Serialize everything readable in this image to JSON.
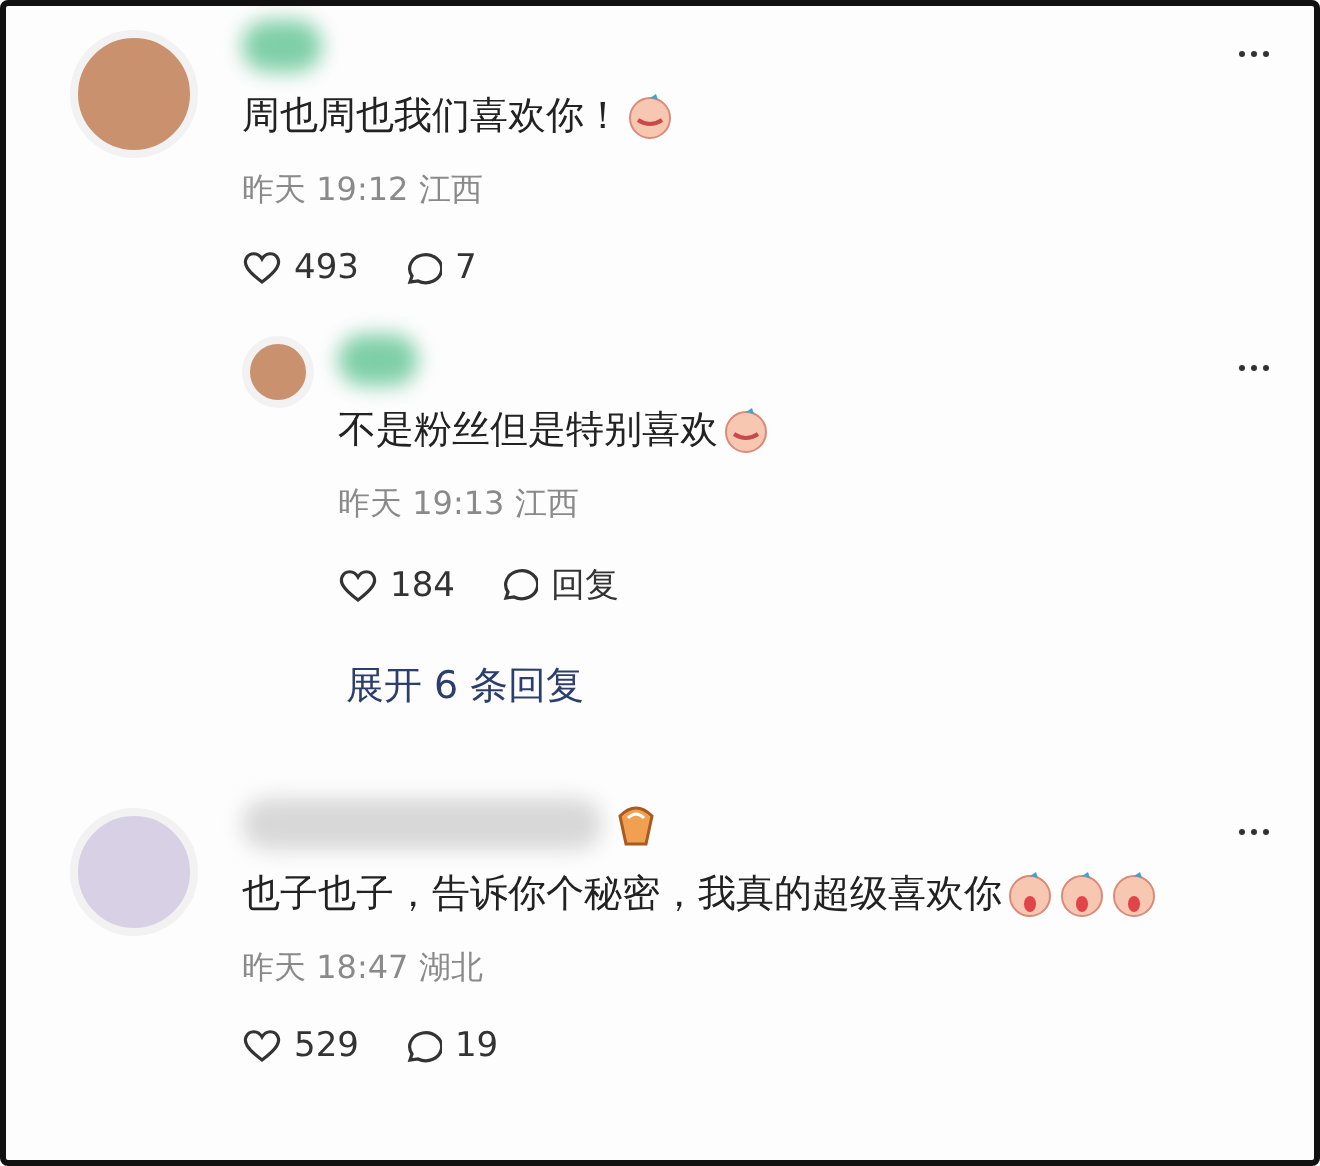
{
  "comments": [
    {
      "text": "周也周也我们喜欢你！",
      "stickers": [
        {
          "kind": "blush"
        }
      ],
      "has_badge": false,
      "time": "昨天 19:12 江西",
      "likes": "493",
      "replies_label": "7",
      "children": [
        {
          "text": "不是粉丝但是特别喜欢",
          "stickers": [
            {
              "kind": "blush"
            }
          ],
          "has_badge": false,
          "time": "昨天 19:13 江西",
          "likes": "184",
          "replies_label": "回复"
        }
      ],
      "expand_label": "展开 6 条回复"
    },
    {
      "text": "也子也子，告诉你个秘密，我真的超级喜欢你",
      "stickers": [
        {
          "kind": "crying"
        },
        {
          "kind": "crying"
        },
        {
          "kind": "crying"
        }
      ],
      "has_badge": true,
      "time": "昨天 18:47 湖北",
      "likes": "529",
      "replies_label": "19"
    }
  ]
}
